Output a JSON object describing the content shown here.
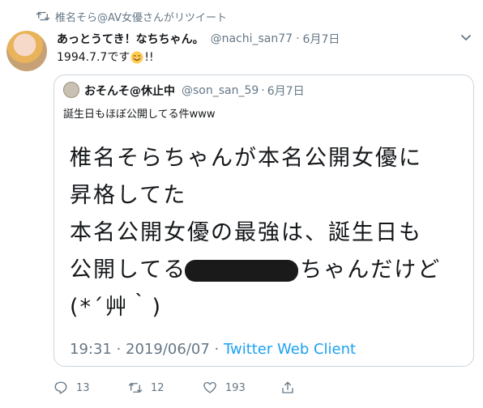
{
  "retweet_context": {
    "text": "椎名そら@AV女優さんがリツイート"
  },
  "tweet": {
    "display_name": "あっとうてき！なちちゃん。",
    "handle": "@nachi_san77",
    "separator": "·",
    "date": "6月7日",
    "text_prefix": "1994.7.7です",
    "text_suffix": "!!",
    "emoji": "smiling-face-emoji"
  },
  "quote": {
    "display_name": "おそんそ@休止中",
    "handle": "@son_san_59",
    "separator": "·",
    "date": "6月7日",
    "text": "誕生日もほぼ公開してる件www",
    "image_lines": [
      "椎名そらちゃんが本名公開女優に",
      "昇格してた",
      "本名公開女優の最強は、誕生日も",
      "公開してる",
      "ちゃんだけど",
      "(*´艸｀)"
    ],
    "meta_time": "19:31 · 2019/06/07 · ",
    "meta_client": "Twitter Web Client"
  },
  "actions": {
    "reply_count": "13",
    "retweet_count": "12",
    "like_count": "193"
  },
  "colors": {
    "secondary": "#657786",
    "link": "#1da1f2",
    "border": "#ccd6dd"
  }
}
